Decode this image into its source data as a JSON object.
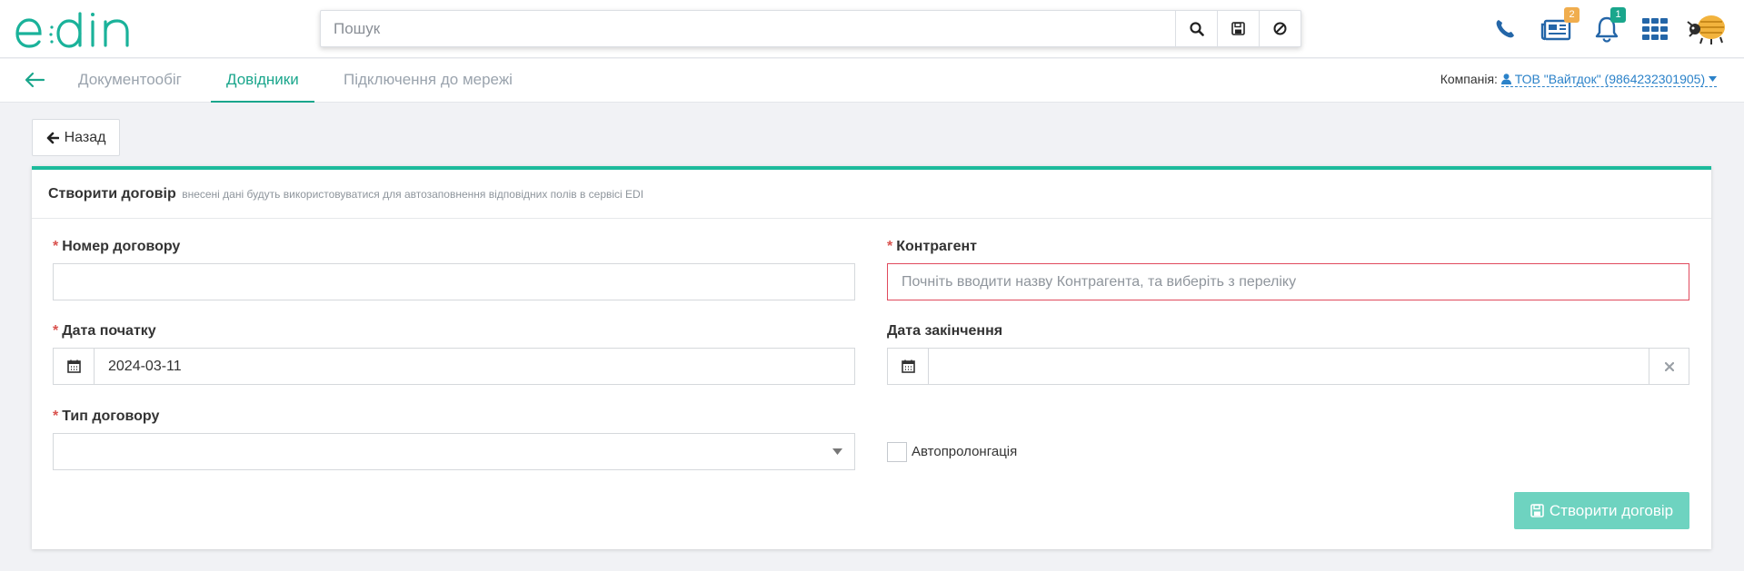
{
  "header": {
    "logo_text": "edin",
    "search": {
      "placeholder": "Пошук",
      "value": ""
    },
    "news_badge": "2",
    "notifications_badge": "1"
  },
  "nav": {
    "tabs": [
      {
        "label": "Документообіг",
        "active": false
      },
      {
        "label": "Довідники",
        "active": true
      },
      {
        "label": "Підключення до мережі",
        "active": false
      }
    ],
    "company_label": "Компанія:",
    "company_name": "ТОВ \"Вайтдок\" (9864232301905)"
  },
  "back_button": {
    "label": "Назад"
  },
  "panel": {
    "title": "Створити договір",
    "subtitle": "внесені дані будуть використовуватися для автозаповнення відповідних полів в сервісі EDI"
  },
  "form": {
    "contract_number": {
      "label": "Номер договору",
      "required": true,
      "value": ""
    },
    "counterparty": {
      "label": "Контрагент",
      "required": true,
      "placeholder": "Почніть вводити назву Контрагента, та виберіть з переліку"
    },
    "start_date": {
      "label": "Дата початку",
      "required": true,
      "value": "2024-03-11"
    },
    "end_date": {
      "label": "Дата закінчення",
      "required": false,
      "value": ""
    },
    "contract_type": {
      "label": "Тип договору",
      "required": true,
      "value": ""
    },
    "auto_prolongation": {
      "label": "Автопролонгація",
      "checked": false
    },
    "submit_label": "Створити договір"
  },
  "colors": {
    "accent": "#1aa68c",
    "panel_border": "#1dbb9c",
    "submit_bg": "#6ed3c0",
    "error_border": "#e04a5d",
    "link": "#2b82c9",
    "icon_blue": "#2466a8",
    "badge_orange": "#f0ad4e",
    "badge_green": "#1aa68c"
  },
  "icons": [
    "phone-icon",
    "news-icon",
    "bell-icon",
    "apps-grid-icon",
    "search-icon",
    "save-icon",
    "ban-icon",
    "arrow-left-icon",
    "user-icon",
    "caret-down-icon",
    "calendar-icon",
    "clear-icon",
    "floppy-icon"
  ]
}
